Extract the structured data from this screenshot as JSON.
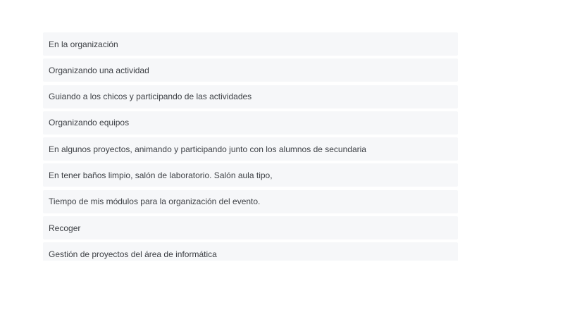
{
  "responses": [
    "En la organización",
    "Organizando una actividad",
    "Guiando a los chicos y participando de las actividades",
    "Organizando equipos",
    "En algunos proyectos, animando y participando junto con los alumnos de secundaria",
    "En tener baños limpio, salón de laboratorio. Salón aula tipo,",
    "Tiempo de mis módulos para la organización del evento.",
    "Recoger",
    "Gestión de proyectos del área de informática"
  ]
}
